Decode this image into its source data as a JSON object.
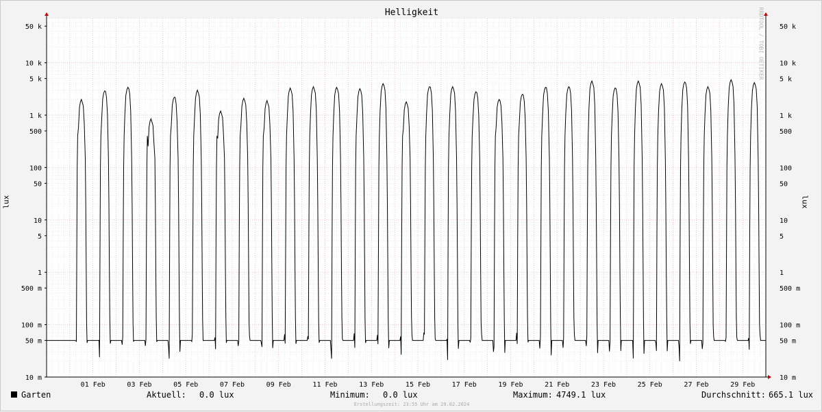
{
  "chart_data": {
    "type": "line",
    "title": "Helligkeit",
    "ylabel": "lux",
    "yscale": "log",
    "ylim": [
      0.01,
      70000
    ],
    "y_tick_labels": [
      {
        "value": 50000,
        "label": "50 k"
      },
      {
        "value": 10000,
        "label": "10 k"
      },
      {
        "value": 5000,
        "label": "5 k"
      },
      {
        "value": 1000,
        "label": "1 k"
      },
      {
        "value": 500,
        "label": "500"
      },
      {
        "value": 100,
        "label": "100"
      },
      {
        "value": 50,
        "label": "50"
      },
      {
        "value": 10,
        "label": "10"
      },
      {
        "value": 5,
        "label": "5"
      },
      {
        "value": 1,
        "label": "1"
      },
      {
        "value": 0.5,
        "label": "500 m"
      },
      {
        "value": 0.1,
        "label": "100 m"
      },
      {
        "value": 0.05,
        "label": "50 m"
      },
      {
        "value": 0.01,
        "label": "10 m"
      }
    ],
    "x_start": "2024-01-30",
    "x_end": "2024-02-29",
    "x_tick_labels": [
      "01 Feb",
      "03 Feb",
      "05 Feb",
      "07 Feb",
      "09 Feb",
      "11 Feb",
      "13 Feb",
      "15 Feb",
      "17 Feb",
      "19 Feb",
      "21 Feb",
      "23 Feb",
      "25 Feb",
      "27 Feb",
      "29 Feb"
    ],
    "x_tick_dates": [
      "2024-02-01",
      "2024-02-03",
      "2024-02-05",
      "2024-02-07",
      "2024-02-09",
      "2024-02-11",
      "2024-02-13",
      "2024-02-15",
      "2024-02-17",
      "2024-02-19",
      "2024-02-21",
      "2024-02-23",
      "2024-02-25",
      "2024-02-27",
      "2024-02-29"
    ],
    "grid": true,
    "series": [
      {
        "name": "Garten",
        "color": "#000000",
        "daily_peaks": [
          {
            "date": "2024-01-31",
            "peak": 2000
          },
          {
            "date": "2024-02-01",
            "peak": 2900
          },
          {
            "date": "2024-02-02",
            "peak": 3400
          },
          {
            "date": "2024-02-03",
            "peak": 850
          },
          {
            "date": "2024-02-04",
            "peak": 2200
          },
          {
            "date": "2024-02-05",
            "peak": 3000
          },
          {
            "date": "2024-02-06",
            "peak": 1200
          },
          {
            "date": "2024-02-07",
            "peak": 2100
          },
          {
            "date": "2024-02-08",
            "peak": 1900
          },
          {
            "date": "2024-02-09",
            "peak": 3300
          },
          {
            "date": "2024-02-10",
            "peak": 3500
          },
          {
            "date": "2024-02-11",
            "peak": 3400
          },
          {
            "date": "2024-02-12",
            "peak": 3200
          },
          {
            "date": "2024-02-13",
            "peak": 4000
          },
          {
            "date": "2024-02-14",
            "peak": 1800
          },
          {
            "date": "2024-02-15",
            "peak": 3500
          },
          {
            "date": "2024-02-16",
            "peak": 3500
          },
          {
            "date": "2024-02-17",
            "peak": 2800
          },
          {
            "date": "2024-02-18",
            "peak": 2000
          },
          {
            "date": "2024-02-19",
            "peak": 2500
          },
          {
            "date": "2024-02-20",
            "peak": 3400
          },
          {
            "date": "2024-02-21",
            "peak": 3500
          },
          {
            "date": "2024-02-22",
            "peak": 4500
          },
          {
            "date": "2024-02-23",
            "peak": 3300
          },
          {
            "date": "2024-02-24",
            "peak": 4500
          },
          {
            "date": "2024-02-25",
            "peak": 4000
          },
          {
            "date": "2024-02-26",
            "peak": 4300
          },
          {
            "date": "2024-02-27",
            "peak": 3500
          },
          {
            "date": "2024-02-28",
            "peak": 4749.1
          },
          {
            "date": "2024-02-29",
            "peak": 4200
          }
        ],
        "night_level": 0.05
      }
    ]
  },
  "watermark": "RRDTOOL / TOBI OETIKER",
  "legend": {
    "series_name": "Garten",
    "current_label": "Aktuell:",
    "current_value": "0.0 lux",
    "min_label": "Minimum:",
    "min_value": "0.0 lux",
    "max_label": "Maximum:",
    "max_value": "4749.1 lux",
    "avg_label": "Durchschnitt:",
    "avg_value": "665.1 lux"
  },
  "footer": "Erstellungszeit: 23:55 Uhr am 29.02.2024",
  "colors": {
    "background": "#f3f3f3",
    "plot": "#ffffff",
    "major_grid": "#e8a0a0",
    "minor_grid": "#dddddd",
    "line": "#000000",
    "arrow": "#cc0000"
  }
}
